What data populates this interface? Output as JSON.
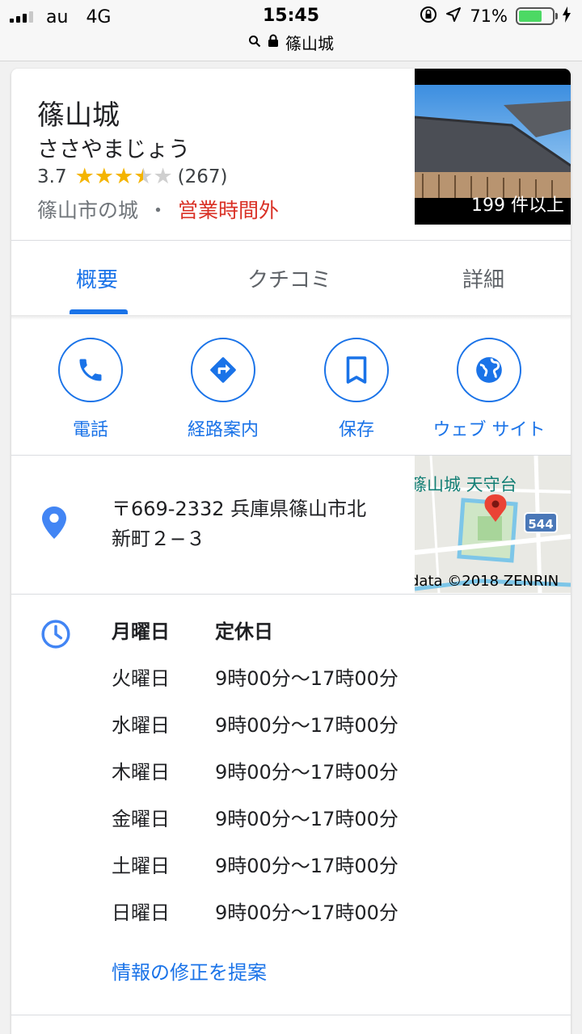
{
  "status_bar": {
    "carrier": "au",
    "network": "4G",
    "time": "15:45",
    "battery_percent": "71%",
    "battery_level": 0.71,
    "url": "篠山城",
    "icons": [
      "signal-icon",
      "orientation-lock-icon",
      "location-arrow-icon",
      "battery-icon",
      "charging-icon",
      "search-icon",
      "lock-icon"
    ]
  },
  "place": {
    "name": "篠山城",
    "reading": "ささやまじょう",
    "rating": "3.7",
    "rating_value": 3.7,
    "review_count": "(267)",
    "category": "篠山市の城",
    "separator": "・",
    "status": "営業時間外",
    "photo_count": "199 件以上"
  },
  "tabs": [
    {
      "label": "概要",
      "active": true
    },
    {
      "label": "クチコミ",
      "active": false
    },
    {
      "label": "詳細",
      "active": false
    }
  ],
  "actions": [
    {
      "label": "電話",
      "icon": "phone-icon"
    },
    {
      "label": "経路案内",
      "icon": "directions-icon"
    },
    {
      "label": "保存",
      "icon": "bookmark-icon"
    },
    {
      "label": "ウェブ サイト",
      "icon": "globe-icon"
    }
  ],
  "address": {
    "line1": "〒669-2332 兵庫県篠山市北",
    "line2": "新町２−３",
    "map_label": "篠山城 天守台",
    "map_route": "544",
    "map_copyright": "data ©2018 ZENRIN"
  },
  "hours": [
    {
      "day": "月曜日",
      "time": "定休日",
      "today": true
    },
    {
      "day": "火曜日",
      "time": "9時00分～17時00分"
    },
    {
      "day": "水曜日",
      "time": "9時00分～17時00分"
    },
    {
      "day": "木曜日",
      "time": "9時00分～17時00分"
    },
    {
      "day": "金曜日",
      "time": "9時00分～17時00分"
    },
    {
      "day": "土曜日",
      "time": "9時00分～17時00分"
    },
    {
      "day": "日曜日",
      "time": "9時00分～17時00分"
    }
  ],
  "suggest_edit": "情報の修正を提案",
  "colors": {
    "accent": "#1a73e8",
    "closed": "#d93025",
    "star": "#f4b400",
    "battery": "#4cd964"
  }
}
